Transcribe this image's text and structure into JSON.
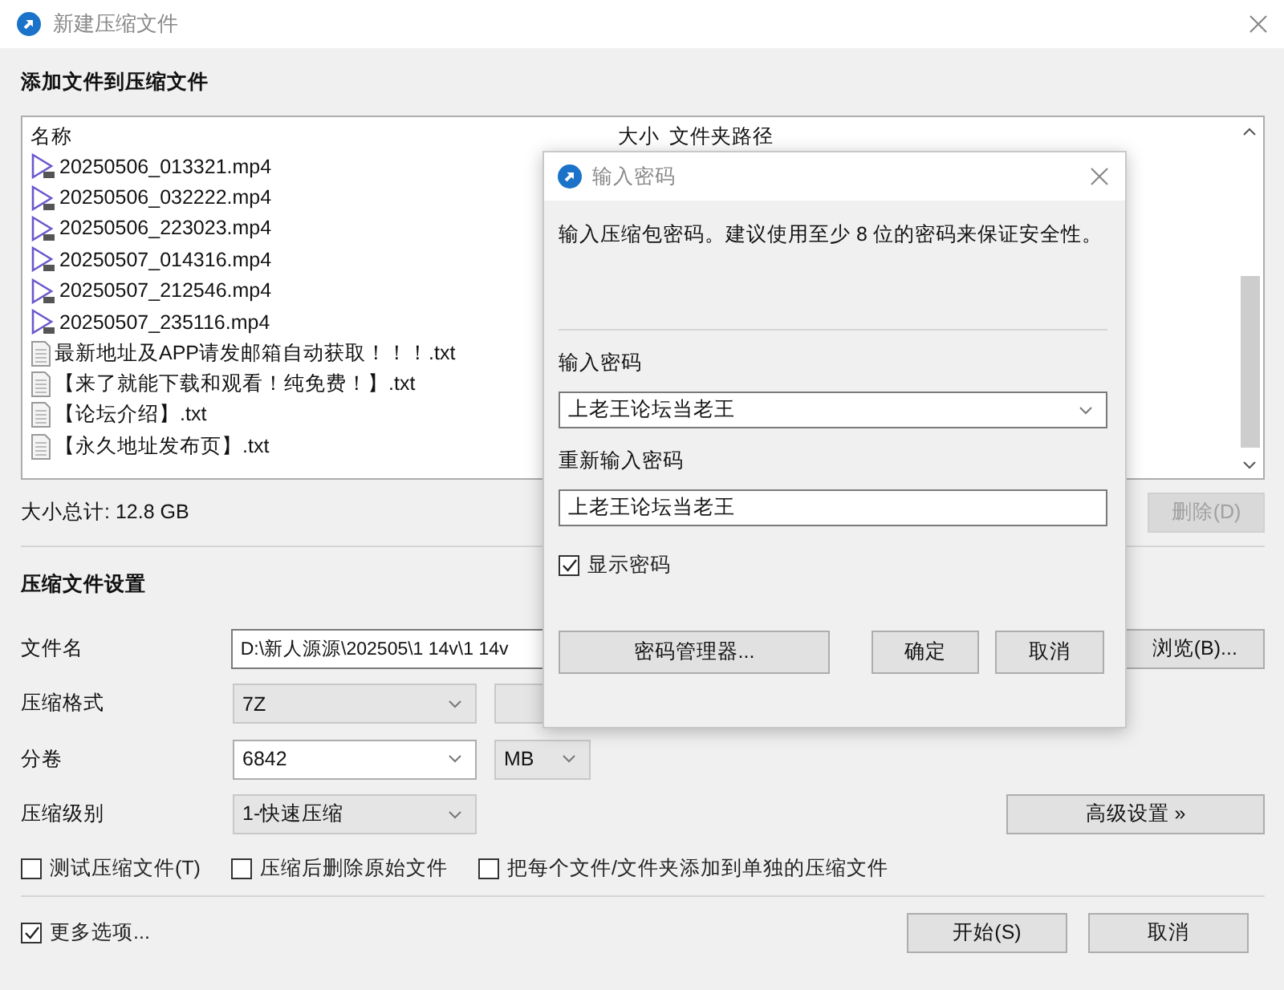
{
  "window": {
    "title": "新建压缩文件"
  },
  "files": {
    "heading": "添加文件到压缩文件",
    "columns": [
      "名称",
      "大小",
      "文件夹路径"
    ],
    "rows": [
      {
        "kind": "video",
        "name": "20250506_013321.mp4"
      },
      {
        "kind": "video",
        "name": "20250506_032222.mp4"
      },
      {
        "kind": "video",
        "name": "20250506_223023.mp4"
      },
      {
        "kind": "video",
        "name": "20250507_014316.mp4"
      },
      {
        "kind": "video",
        "name": "20250507_212546.mp4"
      },
      {
        "kind": "video",
        "name": "20250507_235116.mp4"
      },
      {
        "kind": "text",
        "name": "最新地址及APP请发邮箱自动获取！！！.txt"
      },
      {
        "kind": "text",
        "name": "【来了就能下载和观看！纯免费！】.txt"
      },
      {
        "kind": "text",
        "name": "【论坛介绍】.txt"
      },
      {
        "kind": "text",
        "name": "【永久地址发布页】.txt"
      }
    ]
  },
  "total": "大小总计: 12.8 GB",
  "delete_button": {
    "label": "删除(D)",
    "disabled": true
  },
  "settings": {
    "heading": "压缩文件设置",
    "filename": {
      "label": "文件名",
      "value": "D:\\新人源源\\202505\\1 14v\\1 14v"
    },
    "browse_button": "浏览(B)...",
    "format": {
      "label": "压缩格式",
      "value": "7Z",
      "disabled": true
    },
    "volume": {
      "label": "分卷",
      "value": "6842",
      "unit": "MB"
    },
    "level": {
      "label": "压缩级别",
      "value": "1-快速压缩",
      "disabled": true
    },
    "advanced_button": "高级设置 »",
    "options": [
      {
        "label": "测试压缩文件(T)",
        "checked": false
      },
      {
        "label": "压缩后删除原始文件",
        "checked": false
      },
      {
        "label": "把每个文件/文件夹添加到单独的压缩文件",
        "checked": false
      }
    ]
  },
  "more_options": {
    "label": "更多选项...",
    "checked": true
  },
  "buttons": [
    "开始(S)",
    "取消"
  ],
  "dialog": {
    "title": "输入密码",
    "message": "输入压缩包密码。建议使用至少 8 位的密码来保证安全性。",
    "password_label": "输入密码",
    "password": "上老王论坛当老王",
    "confirm_label": "重新输入密码",
    "confirm": "上老王论坛当老王",
    "show_password": {
      "label": "显示密码",
      "checked": true
    },
    "buttons": [
      "密码管理器...",
      "确定",
      "取消"
    ]
  }
}
